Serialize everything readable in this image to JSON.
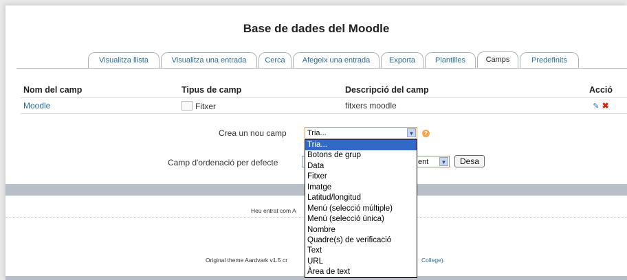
{
  "page_title": "Base de dades del Moodle",
  "tabs": [
    {
      "label": "Visualitza llista",
      "active": false
    },
    {
      "label": "Visualitza una entrada",
      "active": false
    },
    {
      "label": "Cerca",
      "active": false
    },
    {
      "label": "Afegeix una entrada",
      "active": false
    },
    {
      "label": "Exporta",
      "active": false
    },
    {
      "label": "Plantilles",
      "active": false
    },
    {
      "label": "Camps",
      "active": true
    },
    {
      "label": "Predefinits",
      "active": false
    }
  ],
  "table": {
    "headers": [
      "Nom del camp",
      "Tipus de camp",
      "Descripció del camp",
      "Acció"
    ],
    "rows": [
      {
        "name": "Moodle",
        "type": "Fitxer",
        "description": "fitxers moodle"
      }
    ]
  },
  "new_field": {
    "label": "Crea un nou camp",
    "selected": "Tria...",
    "help_icon": "help-icon"
  },
  "sort": {
    "label": "Camp d'ordenació per defecte",
    "order_value": "ent",
    "save_label": "Desa"
  },
  "dropdown_options": [
    "Tria...",
    "Botons de grup",
    "Data",
    "Fitxer",
    "Imatge",
    "Latitud/longitud",
    "Menú (selecció múltiple)",
    "Menú (selecció única)",
    "Nombre",
    "Quadre(s) de verificació",
    "Text",
    "URL",
    "Àrea de text"
  ],
  "footer": {
    "login_text_pre": "Heu entrat com A",
    "theme_text_pre": "Original theme Aardvark v1.5 cr",
    "theme_text_post": "College)."
  },
  "colors": {
    "accent": "#2a6c9a",
    "band": "#b8bfc6",
    "selection": "#316ac5"
  }
}
